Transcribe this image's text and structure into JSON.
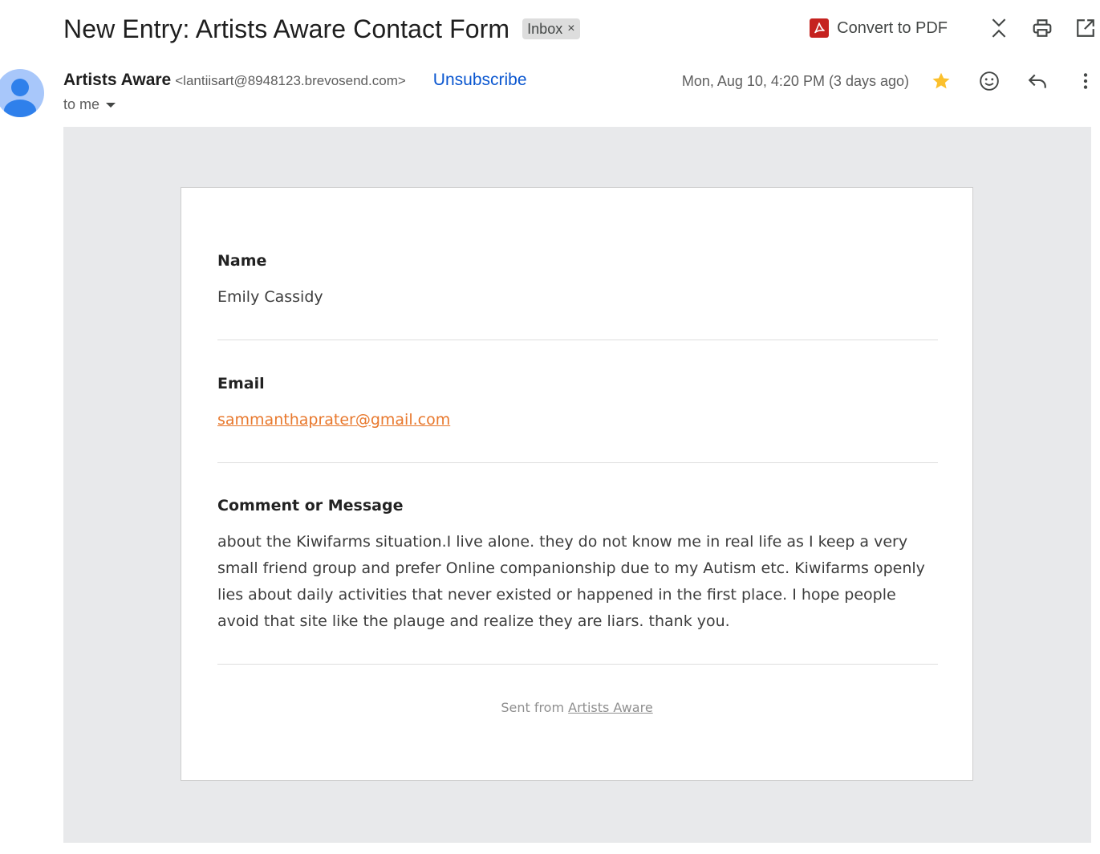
{
  "email": {
    "subject": "New Entry: Artists Aware Contact Form",
    "label": "Inbox",
    "label_remove": "×",
    "convert_pdf": "Convert to PDF",
    "sender_name": "Artists Aware",
    "sender_email": "<lantiisart@8948123.brevosend.com>",
    "unsubscribe": "Unsubscribe",
    "recipient": "to me",
    "date": "Mon, Aug 10, 4:20 PM (3 days ago)",
    "starred": true
  },
  "form": {
    "fields": [
      {
        "label": "Name",
        "value": "Emily Cassidy"
      },
      {
        "label": "Email",
        "value": "sammanthaprater@gmail.com"
      },
      {
        "label": "Comment or Message",
        "value": "about the Kiwifarms situation.I live alone. they do not know me in real life as I keep a very small friend group and prefer Online companionship due to my Autism etc. Kiwifarms openly lies about daily activities that never existed or happened in the first place. I hope people avoid that site like the plauge and realize they are liars. thank you."
      }
    ],
    "footer_prefix": "Sent from",
    "footer_link": "Artists Aware"
  },
  "colors": {
    "link_orange": "#e8782d",
    "unsubscribe_blue": "#0b57d0",
    "star": "#fbc02d",
    "pdf_red": "#c5221f"
  },
  "icons": [
    "pdf-icon",
    "collapse-icon",
    "print-icon",
    "open-in-new-window-icon",
    "avatar",
    "star-icon",
    "emoji-icon",
    "reply-icon",
    "more-vert-icon"
  ]
}
